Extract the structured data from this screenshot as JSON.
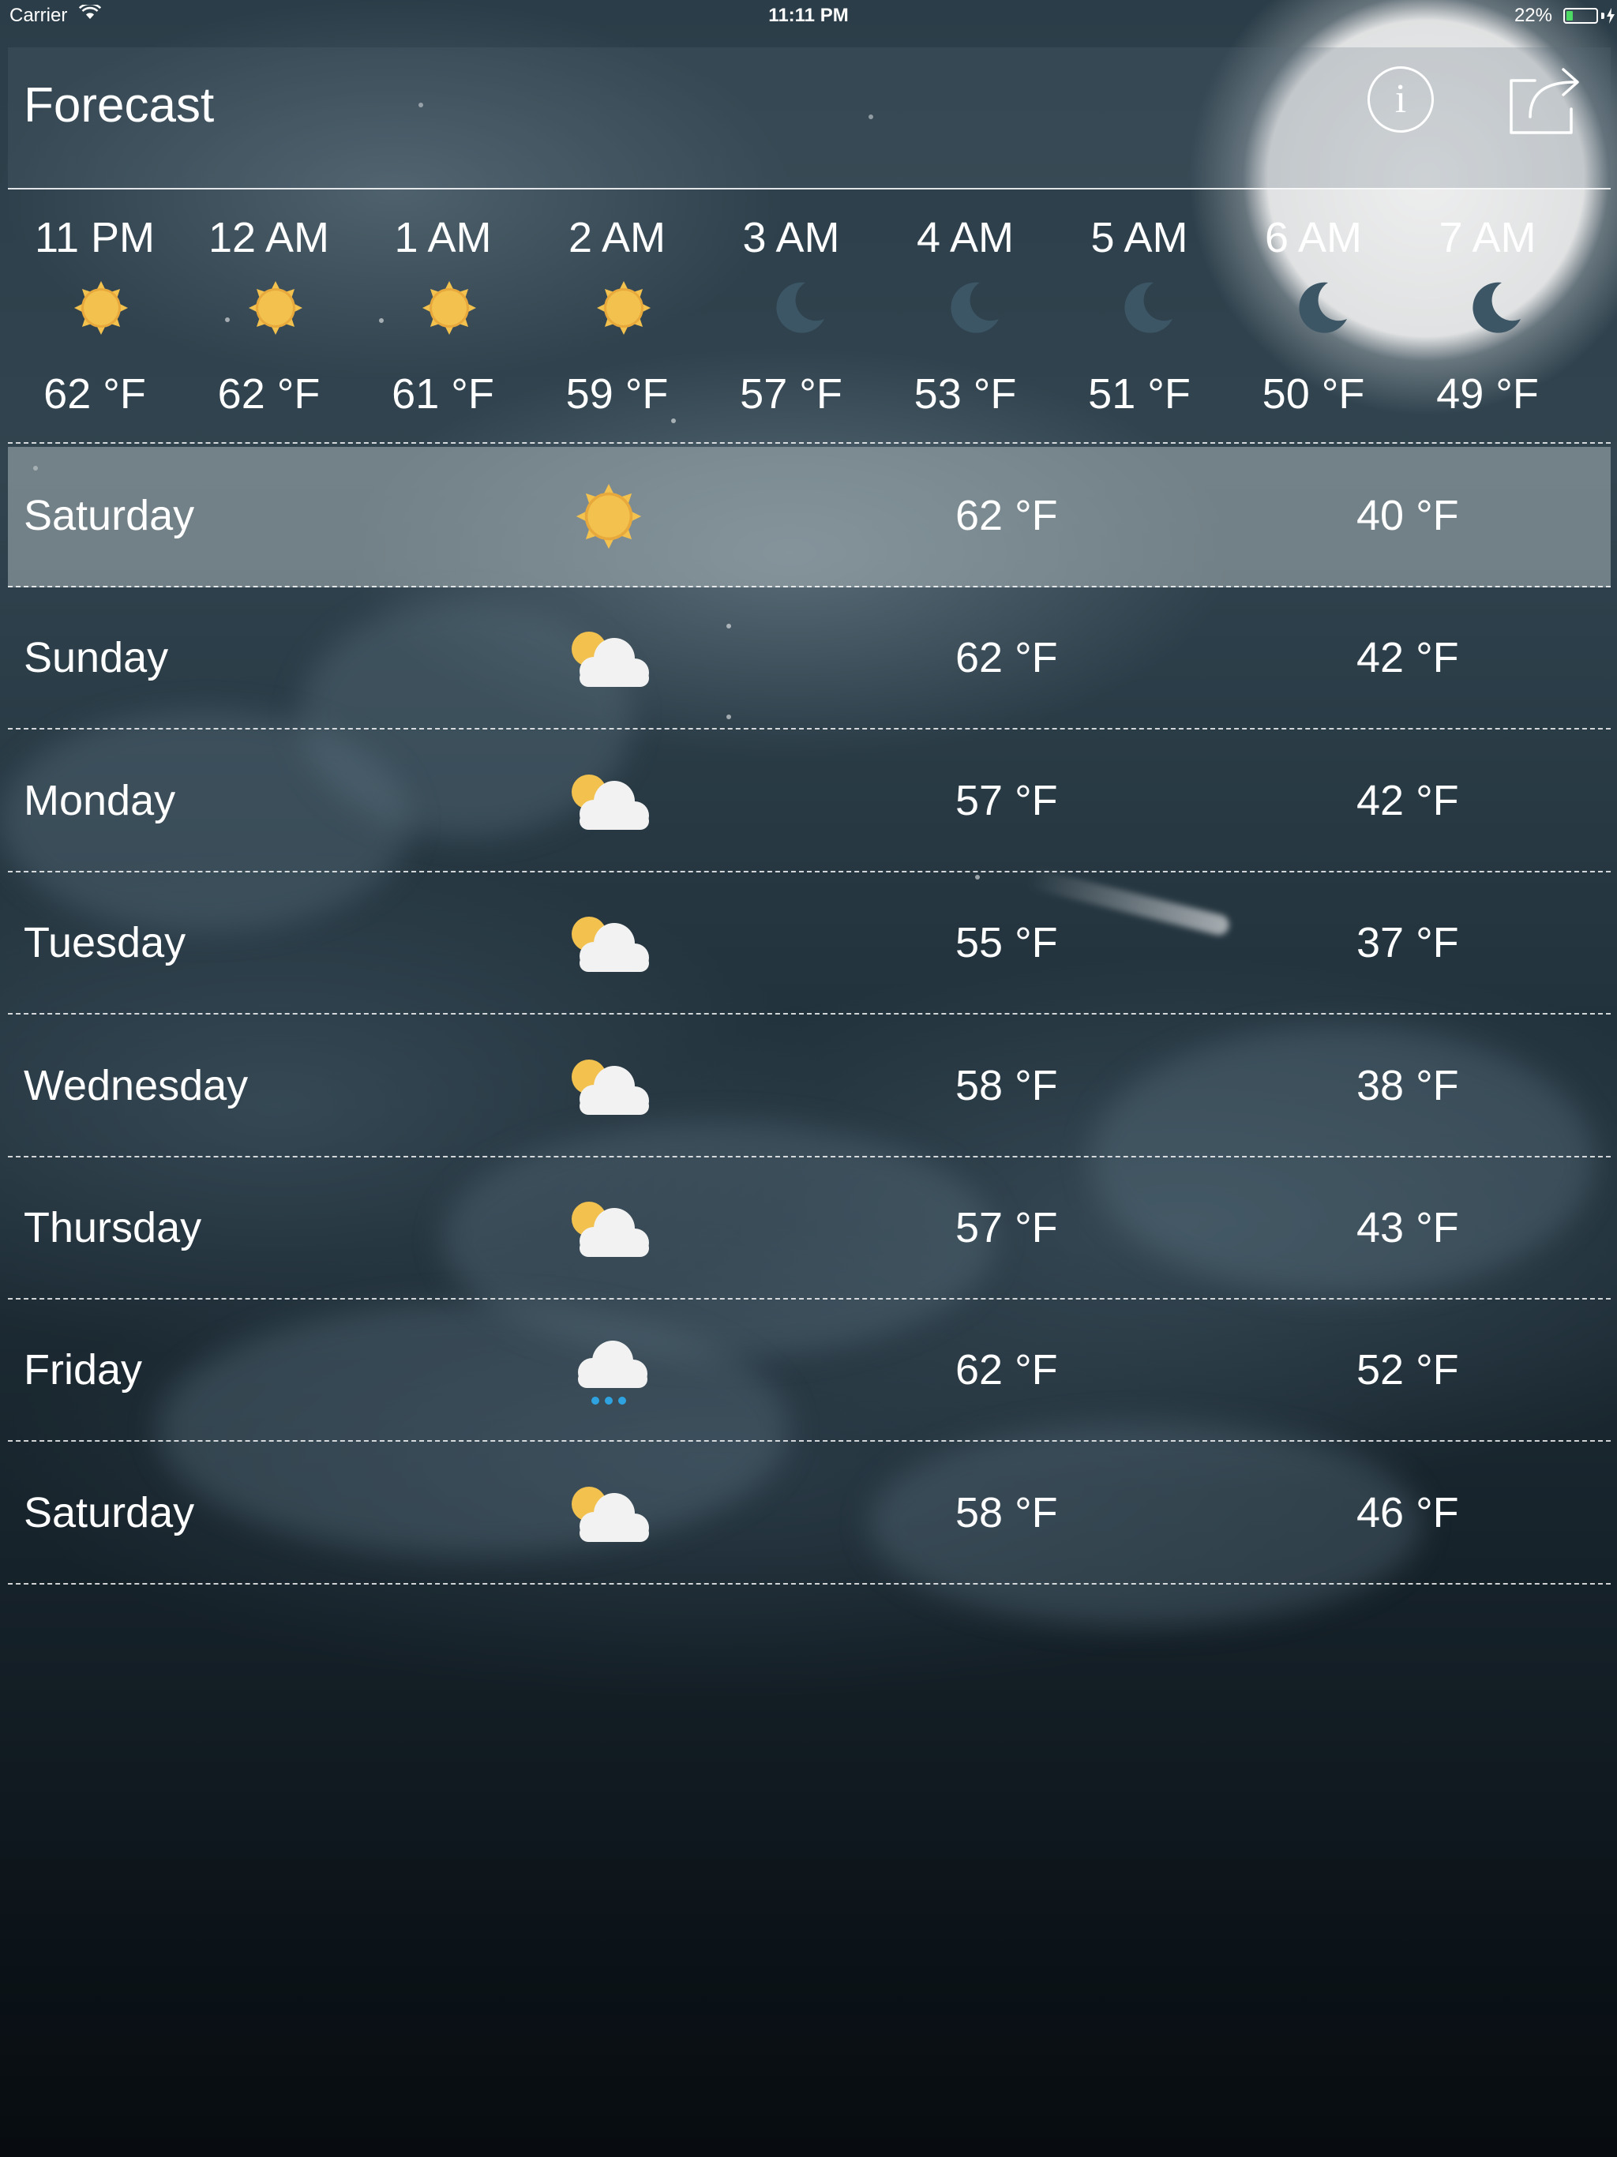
{
  "status_bar": {
    "carrier": "Carrier",
    "time": "11:11 PM",
    "battery_percent": "22%",
    "battery_level": 0.22,
    "battery_color": "#4cd964"
  },
  "header": {
    "title": "Forecast",
    "info_icon": "info-icon",
    "info_glyph": "i",
    "share_icon": "share-icon"
  },
  "hourly": [
    {
      "time": "11 PM",
      "icon": "sun-icon",
      "temp": "62 °F"
    },
    {
      "time": "12 AM",
      "icon": "sun-icon",
      "temp": "62 °F"
    },
    {
      "time": "1 AM",
      "icon": "sun-icon",
      "temp": "61 °F"
    },
    {
      "time": "2 AM",
      "icon": "sun-icon",
      "temp": "59 °F"
    },
    {
      "time": "3 AM",
      "icon": "moon-icon",
      "temp": "57 °F"
    },
    {
      "time": "4 AM",
      "icon": "moon-icon",
      "temp": "53 °F"
    },
    {
      "time": "5 AM",
      "icon": "moon-icon",
      "temp": "51 °F"
    },
    {
      "time": "6 AM",
      "icon": "moon-icon",
      "temp": "50 °F"
    },
    {
      "time": "7 AM",
      "icon": "moon-icon",
      "temp": "49 °F"
    }
  ],
  "daily": [
    {
      "day": "Saturday",
      "icon": "sun-icon",
      "high": "62 °F",
      "low": "40 °F",
      "selected": true
    },
    {
      "day": "Sunday",
      "icon": "partly-cloudy-icon",
      "high": "62 °F",
      "low": "42 °F"
    },
    {
      "day": "Monday",
      "icon": "partly-cloudy-icon",
      "high": "57 °F",
      "low": "42 °F"
    },
    {
      "day": "Tuesday",
      "icon": "partly-cloudy-icon",
      "high": "55 °F",
      "low": "37 °F"
    },
    {
      "day": "Wednesday",
      "icon": "partly-cloudy-icon",
      "high": "58 °F",
      "low": "38 °F"
    },
    {
      "day": "Thursday",
      "icon": "partly-cloudy-icon",
      "high": "57 °F",
      "low": "43 °F"
    },
    {
      "day": "Friday",
      "icon": "rain-icon",
      "high": "62 °F",
      "low": "52 °F"
    },
    {
      "day": "Saturday",
      "icon": "partly-cloudy-icon",
      "high": "58 °F",
      "low": "46 °F"
    }
  ],
  "colors": {
    "sun": "#f2c14e",
    "sun_edge": "#e8a93c",
    "moon": "#3c5666",
    "cloud": "#f2f2f2",
    "rain": "#2ea3e0"
  }
}
